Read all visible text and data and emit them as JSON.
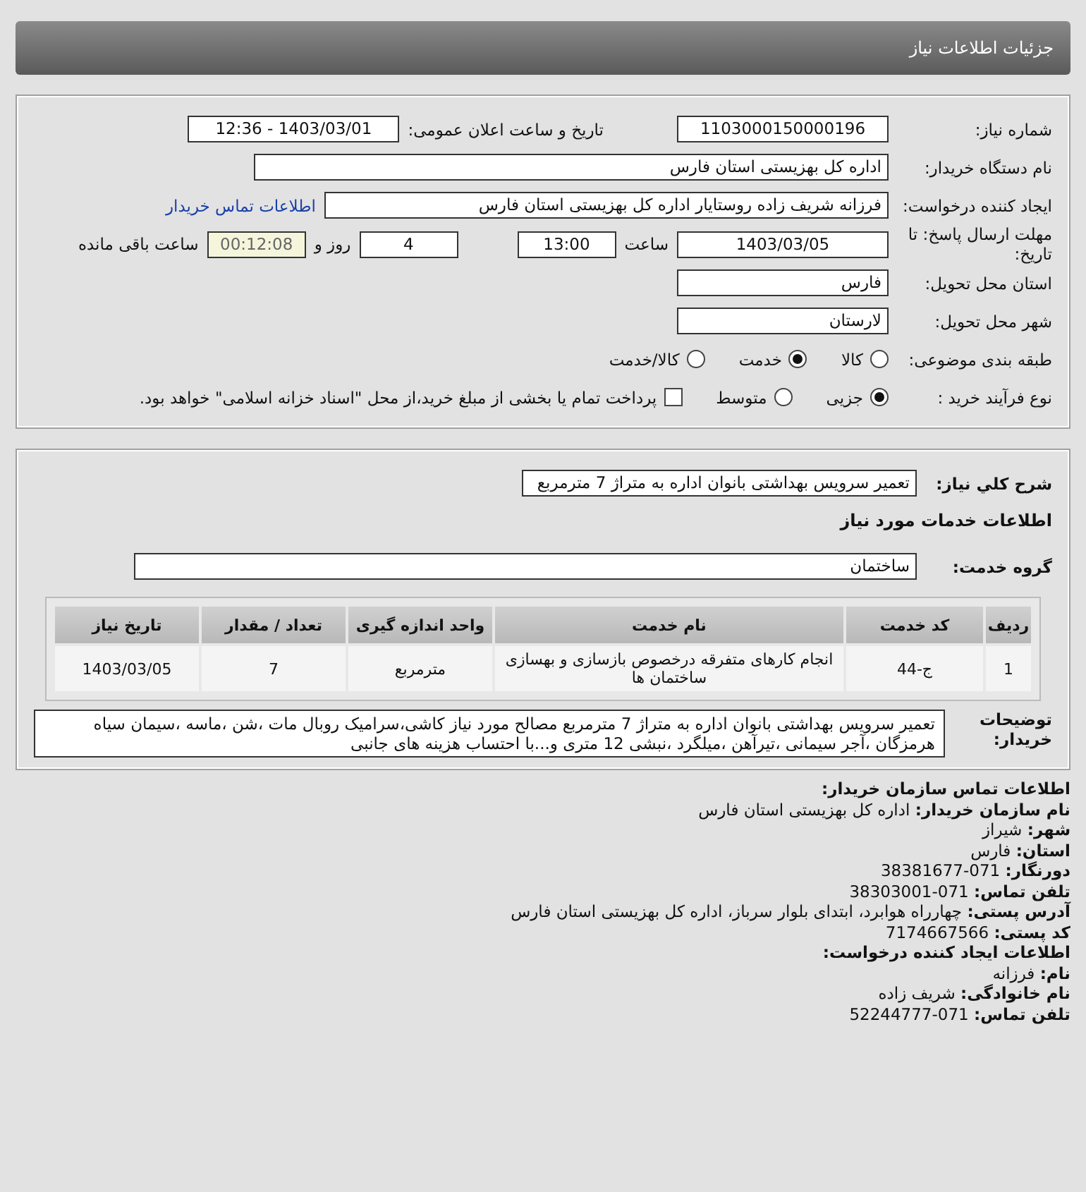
{
  "header": {
    "title": "جزئیات اطلاعات نیاز"
  },
  "details": {
    "need_number": {
      "label": "شماره نیاز:",
      "value": "1103000150000196"
    },
    "announce": {
      "label": "تاریخ و ساعت اعلان عمومی:",
      "value": "1403/03/01 - 12:36"
    },
    "buyer": {
      "label": "نام دستگاه خریدار:",
      "value": "اداره کل بهزیستی استان فارس"
    },
    "creator": {
      "label": "ایجاد کننده درخواست:",
      "value": "فرزانه شریف زاده روستایار اداره کل بهزیستی استان فارس",
      "link": "اطلاعات تماس خریدار"
    },
    "deadline": {
      "label": "مهلت ارسال پاسخ: تا تاریخ:",
      "date": "1403/03/05",
      "time_label": "ساعت",
      "time": "13:00",
      "days": "4",
      "days_label": "روز و",
      "remaining": "00:12:08",
      "remaining_label": "ساعت باقی مانده"
    },
    "province": {
      "label": "استان محل تحویل:",
      "value": "فارس"
    },
    "city": {
      "label": "شهر محل تحویل:",
      "value": "لارستان"
    },
    "category": {
      "label": "طبقه بندی موضوعی:",
      "options": [
        {
          "label": "کالا",
          "selected": false
        },
        {
          "label": "خدمت",
          "selected": true
        },
        {
          "label": "کالا/خدمت",
          "selected": false
        }
      ]
    },
    "purchase": {
      "label": "نوع فرآیند خرید :",
      "options": [
        {
          "label": "جزیی",
          "selected": true
        },
        {
          "label": "متوسط",
          "selected": false
        }
      ],
      "checkbox": {
        "label": "پرداخت تمام یا بخشی از مبلغ خرید،از محل \"اسناد خزانه اسلامی\" خواهد بود.",
        "checked": false
      }
    }
  },
  "services": {
    "summary": {
      "label": "شرح کلي نياز:",
      "value": "تعمیر سرویس بهداشتی بانوان اداره به متراژ 7 مترمربع"
    },
    "heading": "اطلاعات خدمات مورد نیاز",
    "group": {
      "label": "گروه خدمت:",
      "value": "ساختمان"
    },
    "table": {
      "columns": [
        "ردیف",
        "کد خدمت",
        "نام خدمت",
        "واحد اندازه گیری",
        "تعداد / مقدار",
        "تاریخ نیاز"
      ],
      "rows": [
        [
          "1",
          "ج-44",
          "انجام کارهای متفرقه درخصوص بازسازی و بهسازی ساختمان ها",
          "مترمربع",
          "7",
          "1403/03/05"
        ]
      ]
    },
    "description": {
      "label": "توضیحات خریدار:",
      "value": "تعمیر سرویس بهداشتی بانوان اداره به متراژ 7 مترمربع مصالح مورد نیاز کاشی،سرامیک روبال مات ،شن ،ماسه ،سیمان سیاه هرمزگان ،آجر سیمانی ،تیرآهن ،میلگرد ،نبشی 12 متری و...با احتساب هزینه های جانبی"
    }
  },
  "contact": [
    {
      "kind": "heading",
      "text": "اطلاعات تماس سازمان خریدار:"
    },
    {
      "kind": "line",
      "text": "**نام سازمان خریدار:** اداره کل بهزیستی استان فارس"
    },
    {
      "kind": "line",
      "text": "**شهر:** شیراز"
    },
    {
      "kind": "line",
      "text": "**استان:** فارس"
    },
    {
      "kind": "line",
      "text": "**دورنگار:** 071-38381677"
    },
    {
      "kind": "line",
      "text": "**تلفن تماس:** 071-38303001"
    },
    {
      "kind": "line",
      "text": "**آدرس پستی:** چهارراه هوابرد، ابتدای بلوار سرباز، اداره کل بهزیستی استان فارس"
    },
    {
      "kind": "line",
      "text": "**کد پستی:** 7174667566"
    },
    {
      "kind": "heading",
      "text": "اطلاعات ایجاد کننده درخواست:"
    },
    {
      "kind": "line",
      "text": "**نام:** فرزانه"
    },
    {
      "kind": "line",
      "text": "**نام خانوادگی:** شریف زاده"
    },
    {
      "kind": "line",
      "text": "**تلفن تماس:** 071-52244777"
    }
  ]
}
